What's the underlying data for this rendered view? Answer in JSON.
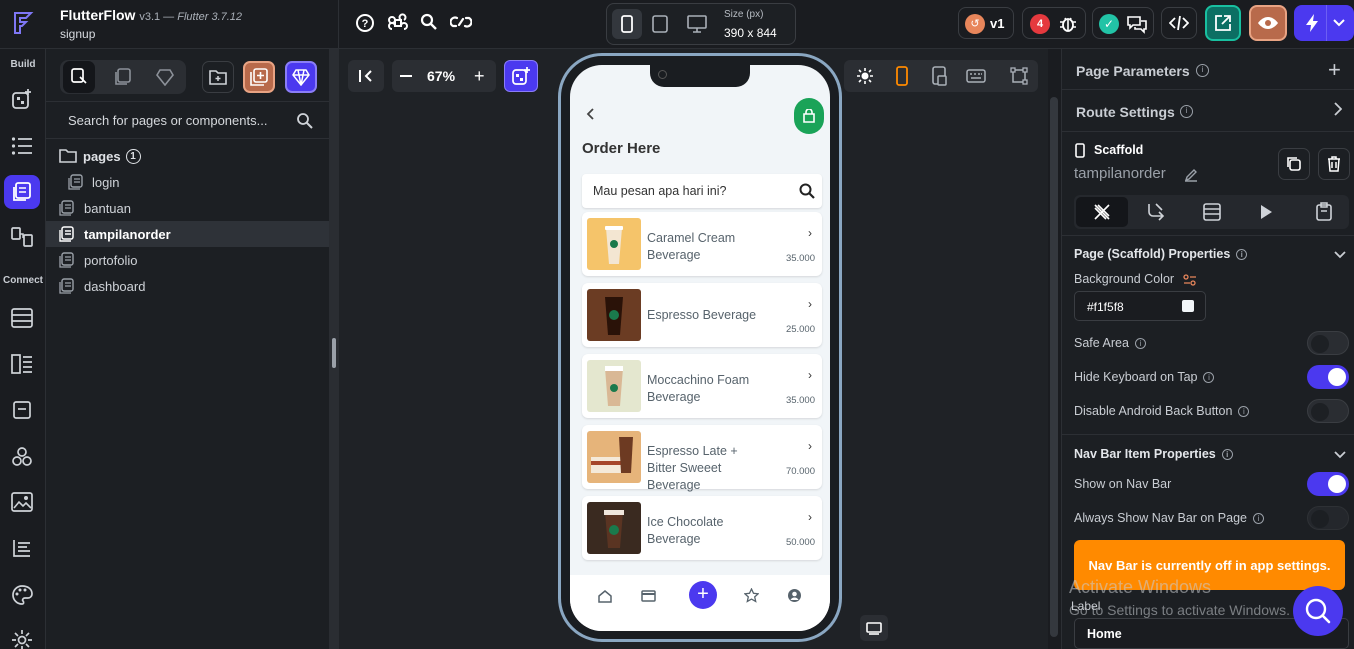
{
  "app": {
    "name": "FlutterFlow",
    "version": "v3.1 — ",
    "flutter": "Flutter 3.7.12",
    "project": "signup"
  },
  "topbar": {
    "size_label": "Size (px)",
    "size_value": "390 x 844",
    "version_badge": "v1",
    "issues_count": "4"
  },
  "rail": {
    "build_label": "Build",
    "connect_label": "Connect"
  },
  "left": {
    "search_placeholder": "Search for pages or components...",
    "folder": "pages",
    "folder_count": "1",
    "pages": [
      "login",
      "bantuan",
      "tampilanorder",
      "portofolio",
      "dashboard"
    ]
  },
  "canvas": {
    "zoom": "67%"
  },
  "phone": {
    "title": "Order Here",
    "search_placeholder": "Mau pesan apa hari ini?",
    "items": [
      {
        "name": "Caramel Cream Beverage",
        "price": "35.000"
      },
      {
        "name": "Espresso Beverage",
        "price": "25.000"
      },
      {
        "name": "Moccachino Foam Beverage",
        "price": "35.000"
      },
      {
        "name": "Espresso Late + Bitter Sweeet Beverage",
        "price": "70.000"
      },
      {
        "name": "Ice Chocolate Beverage",
        "price": "50.000"
      }
    ]
  },
  "right": {
    "page_params": "Page Parameters",
    "route_settings": "Route Settings",
    "widget_type": "Scaffold",
    "widget_name": "tampilanorder",
    "scaffold_props": "Page (Scaffold) Properties",
    "bg_color_label": "Background Color",
    "bg_color_value": "#f1f5f8",
    "safe_area": "Safe Area",
    "hide_keyboard": "Hide Keyboard on Tap",
    "disable_back": "Disable Android Back Button",
    "navbar_props": "Nav Bar Item Properties",
    "show_navbar": "Show on Nav Bar",
    "always_show": "Always Show Nav Bar on Page",
    "warning": "Nav Bar is currently off in app settings.",
    "label_label": "Label",
    "label_value": "Home",
    "watermark1": "Activate Windows",
    "watermark2": "Go to Settings to activate Windows."
  },
  "colors": {
    "accent": "#4b39ef",
    "orange": "#ff8a00",
    "green": "#2aa84a",
    "orange_btn": "#d4845e"
  }
}
